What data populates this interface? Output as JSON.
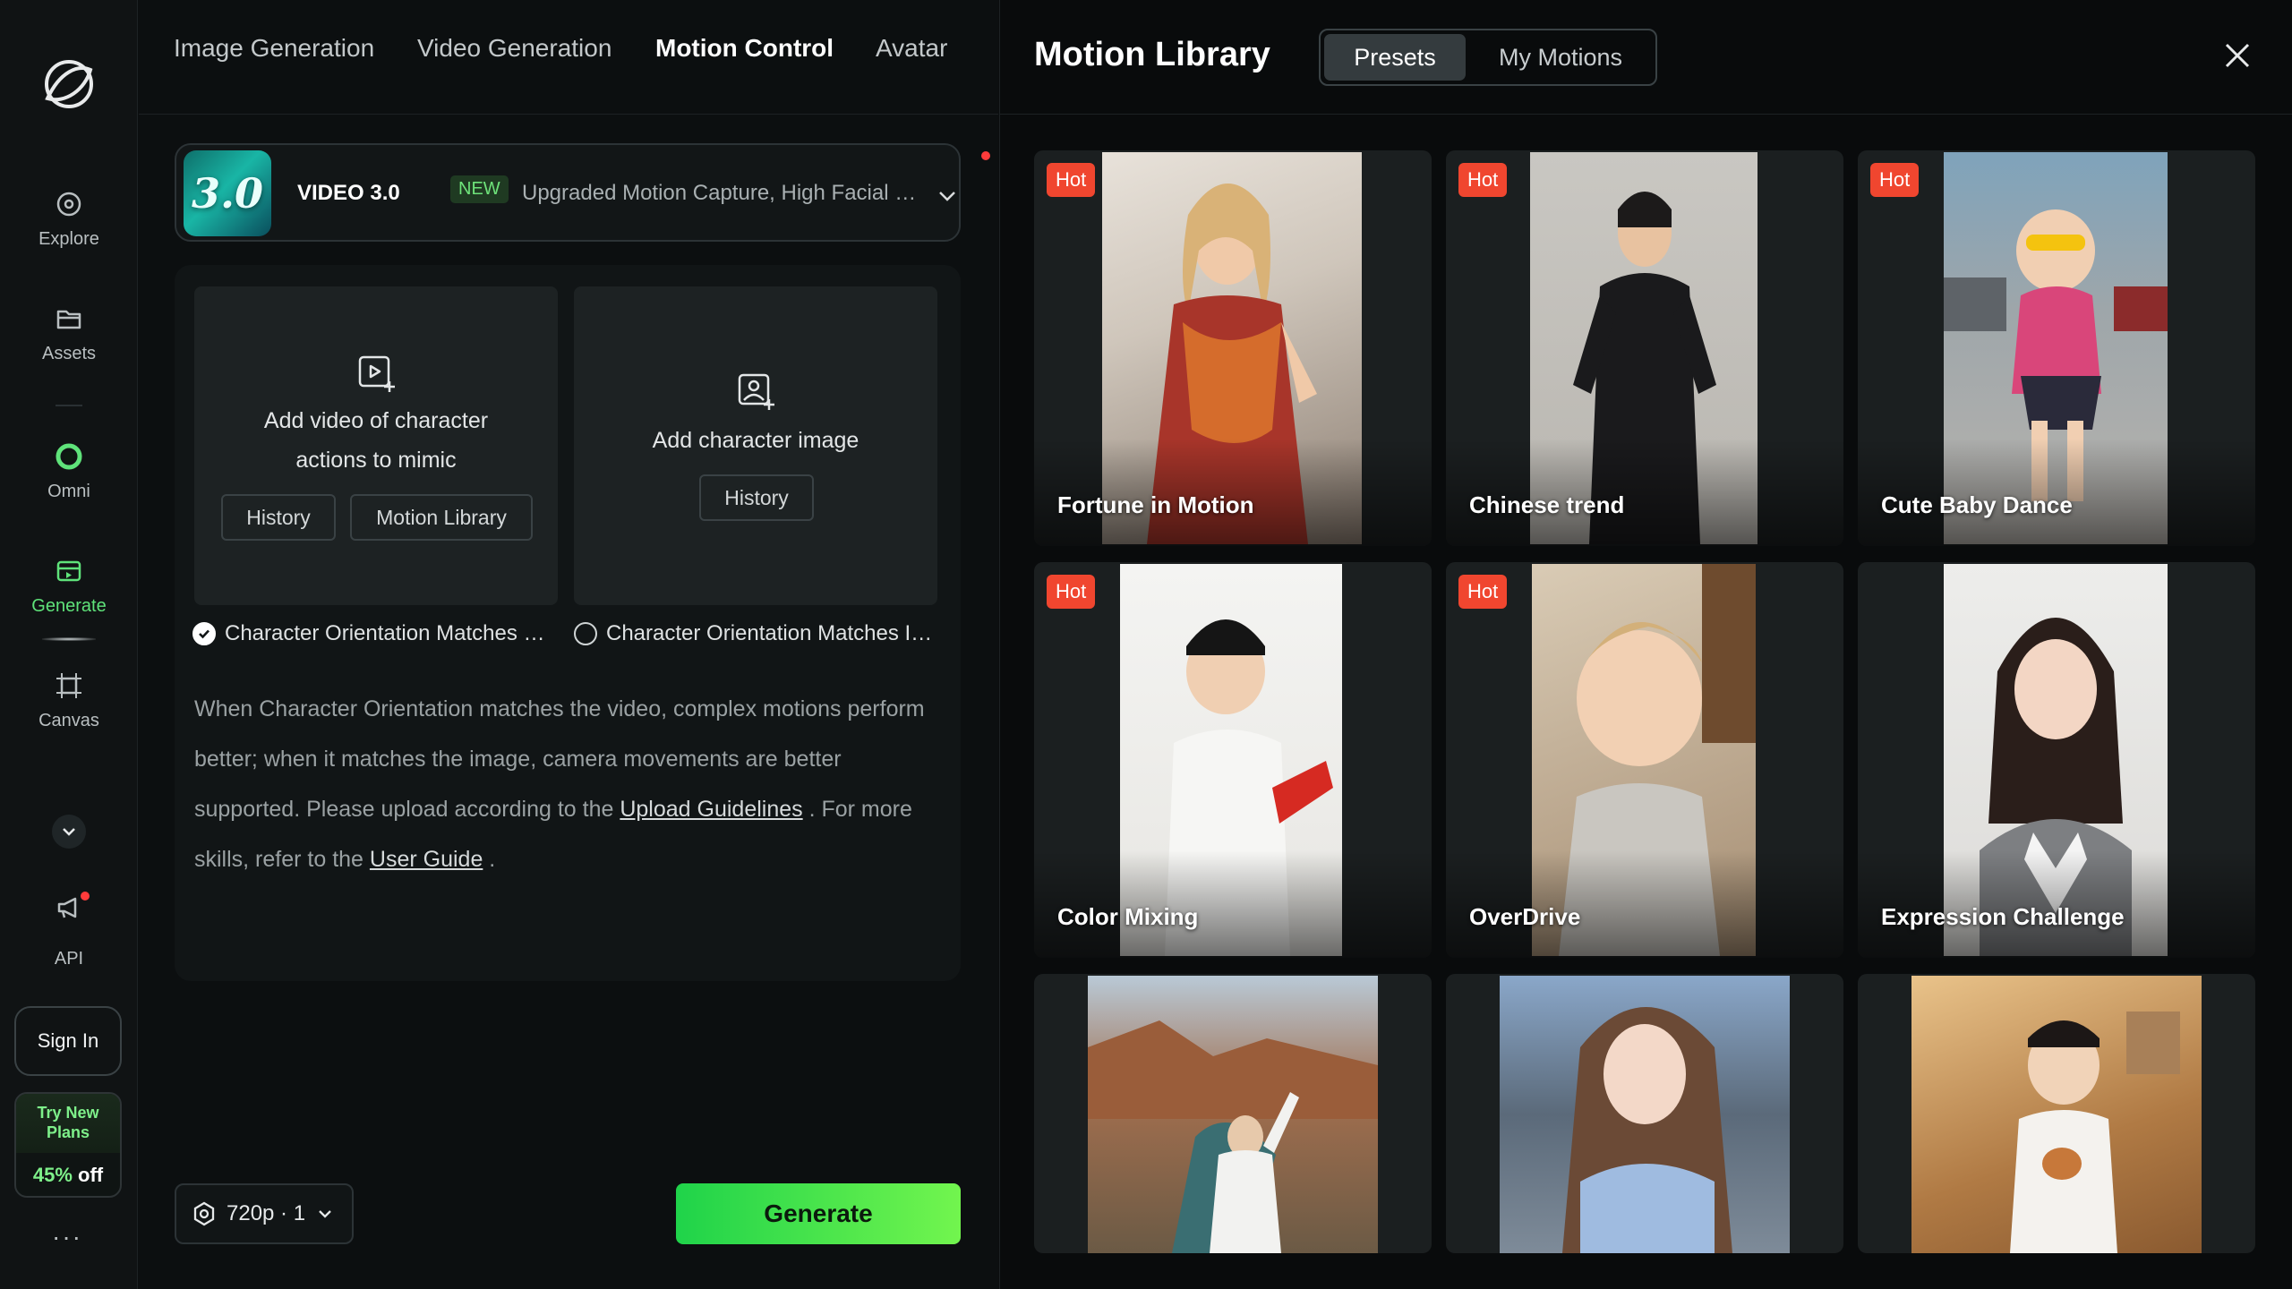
{
  "sidebar": {
    "items": [
      {
        "label": "Explore",
        "icon": "explore-icon"
      },
      {
        "label": "Assets",
        "icon": "folder-icon"
      },
      {
        "label": "Omni",
        "icon": "omni-ring-icon"
      },
      {
        "label": "Generate",
        "icon": "generate-icon"
      },
      {
        "label": "Canvas",
        "icon": "canvas-frame-icon"
      },
      {
        "label": "API",
        "icon": "megaphone-icon"
      }
    ],
    "sign_in": "Sign In",
    "plans_line1": "Try New",
    "plans_line2": "Plans",
    "plans_discount": "45%",
    "plans_off": "off",
    "more": "···",
    "accent_color": "#5fe37a"
  },
  "tabs": [
    "Image Generation",
    "Video Generation",
    "Motion Control",
    "Avatar"
  ],
  "model": {
    "thumb_text": "3.0",
    "name": "VIDEO 3.0",
    "badge": "NEW",
    "description": "Upgraded Motion Capture, High Facial Consistency"
  },
  "upload": {
    "video_card_line1": "Add video of character",
    "video_card_line2": "actions to mimic",
    "image_card_title": "Add character image",
    "history": "History",
    "motion_library": "Motion Library",
    "orientation_video": "Character Orientation Matches Video",
    "orientation_image": "Character Orientation Matches Image",
    "help_text_1": "When Character Orientation matches the video, complex motions perform better; when it matches the image, camera movements are better supported. Please upload according to the ",
    "help_link_1": "Upload Guidelines",
    "help_text_2": " . For more skills, refer to the ",
    "help_link_2": "User Guide",
    "help_text_3": " ."
  },
  "footer": {
    "resolution": "720p · 1",
    "generate": "Generate",
    "generate_colors": [
      "#1fd34a",
      "#72f54e"
    ]
  },
  "library": {
    "title": "Motion Library",
    "tabs": [
      "Presets",
      "My Motions"
    ],
    "hot_label": "Hot",
    "cards": [
      {
        "name": "Fortune in Motion",
        "hot": true
      },
      {
        "name": "Chinese trend",
        "hot": true
      },
      {
        "name": "Cute Baby Dance",
        "hot": true
      },
      {
        "name": "Color Mixing",
        "hot": true
      },
      {
        "name": "OverDrive",
        "hot": true
      },
      {
        "name": "Expression Challenge",
        "hot": false
      },
      {
        "name": "",
        "hot": false
      },
      {
        "name": "",
        "hot": false
      },
      {
        "name": "",
        "hot": false
      }
    ]
  }
}
